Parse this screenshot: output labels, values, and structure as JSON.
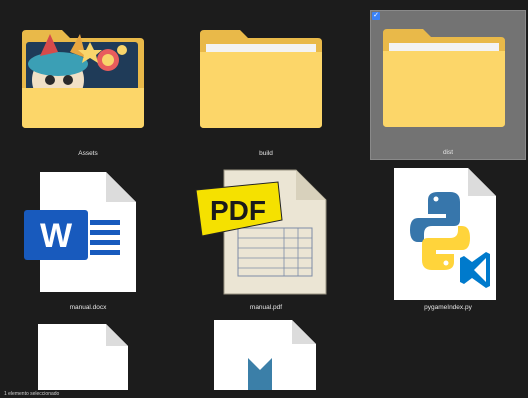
{
  "files": [
    {
      "name": "Assets",
      "kind": "folder-image",
      "selected": false
    },
    {
      "name": "build",
      "kind": "folder",
      "selected": false
    },
    {
      "name": "dist",
      "kind": "folder",
      "selected": true
    },
    {
      "name": "manual.docx",
      "kind": "word",
      "selected": false
    },
    {
      "name": "manual.pdf",
      "kind": "pdf",
      "selected": false
    },
    {
      "name": "pygameIndex.py",
      "kind": "python",
      "selected": false
    },
    {
      "name": "",
      "kind": "blank",
      "selected": false
    },
    {
      "name": "",
      "kind": "download",
      "selected": false
    }
  ],
  "pdf_logo_text": "PDF",
  "word_logo_text": "W",
  "status": {
    "text": "1 elemento seleccionado"
  },
  "colors": {
    "folder_back": "#e9b949",
    "folder_front": "#fcd669",
    "selection": "#737373",
    "word_blue": "#185abd",
    "python_blue": "#3776ab",
    "python_yellow": "#ffd43b",
    "vscode_blue": "#007acc"
  }
}
